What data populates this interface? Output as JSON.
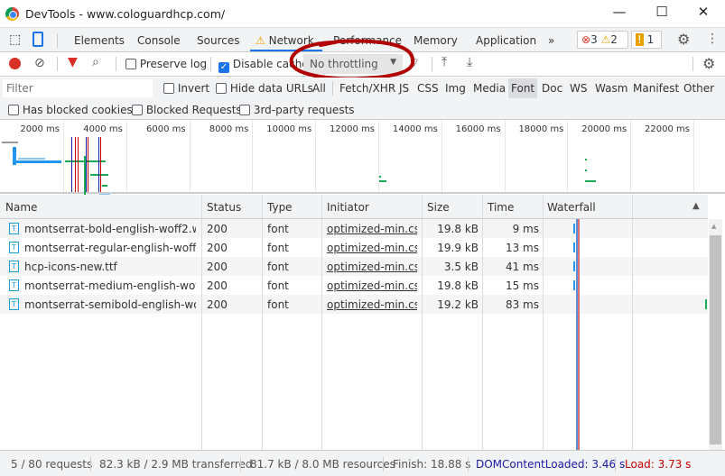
{
  "window": {
    "title": "DevTools - www.cologuardhcp.com/"
  },
  "tabs": [
    {
      "label": "Elements"
    },
    {
      "label": "Console"
    },
    {
      "label": "Sources"
    },
    {
      "label": "Network",
      "active": true,
      "warning": true
    },
    {
      "label": "Performance"
    },
    {
      "label": "Memory"
    },
    {
      "label": "Application"
    }
  ],
  "badges": {
    "errors": "3",
    "warnings": "2",
    "issues": "1"
  },
  "toolbar": {
    "preserve_log": "Preserve log",
    "disable_cache": "Disable cache",
    "throttling": "No throttling"
  },
  "filter": {
    "placeholder": "Filter",
    "invert": "Invert",
    "hide_data_urls": "Hide data URLs",
    "types": [
      "All",
      "Fetch/XHR",
      "JS",
      "CSS",
      "Img",
      "Media",
      "Font",
      "Doc",
      "WS",
      "Wasm",
      "Manifest",
      "Other"
    ],
    "active_type": "Font"
  },
  "checkboxes": {
    "blocked_cookies": "Has blocked cookies",
    "blocked_requests": "Blocked Requests",
    "third_party": "3rd-party requests"
  },
  "overview": {
    "ticks": [
      "2000 ms",
      "4000 ms",
      "6000 ms",
      "8000 ms",
      "10000 ms",
      "12000 ms",
      "14000 ms",
      "16000 ms",
      "18000 ms",
      "20000 ms",
      "22000 ms"
    ]
  },
  "columns": [
    "Name",
    "Status",
    "Type",
    "Initiator",
    "Size",
    "Time",
    "Waterfall"
  ],
  "rows": [
    {
      "name": "montserrat-bold-english-woff2.wo...",
      "status": "200",
      "type": "font",
      "initiator": "optimized-min.cs...",
      "size": "19.8 kB",
      "time": "9 ms"
    },
    {
      "name": "montserrat-regular-english-woff2...",
      "status": "200",
      "type": "font",
      "initiator": "optimized-min.cs...",
      "size": "19.9 kB",
      "time": "13 ms"
    },
    {
      "name": "hcp-icons-new.ttf",
      "status": "200",
      "type": "font",
      "initiator": "optimized-min.cs...",
      "size": "3.5 kB",
      "time": "41 ms"
    },
    {
      "name": "montserrat-medium-english-woff...",
      "status": "200",
      "type": "font",
      "initiator": "optimized-min.cs...",
      "size": "19.8 kB",
      "time": "15 ms"
    },
    {
      "name": "montserrat-semibold-english-woff...",
      "status": "200",
      "type": "font",
      "initiator": "optimized-min.cs...",
      "size": "19.2 kB",
      "time": "83 ms"
    }
  ],
  "status": {
    "requests": "5 / 80 requests",
    "transferred": "82.3 kB / 2.9 MB transferred",
    "resources": "81.7 kB / 8.0 MB resources",
    "finish": "Finish: 18.88 s",
    "dcl": "DOMContentLoaded: 3.46 s",
    "load": "Load: 3.73 s"
  },
  "colors": {
    "accent": "#1a73e8",
    "record": "#d93025",
    "dcl": "#1a1aa6",
    "load": "#c80000",
    "annotation": "#b00000"
  }
}
